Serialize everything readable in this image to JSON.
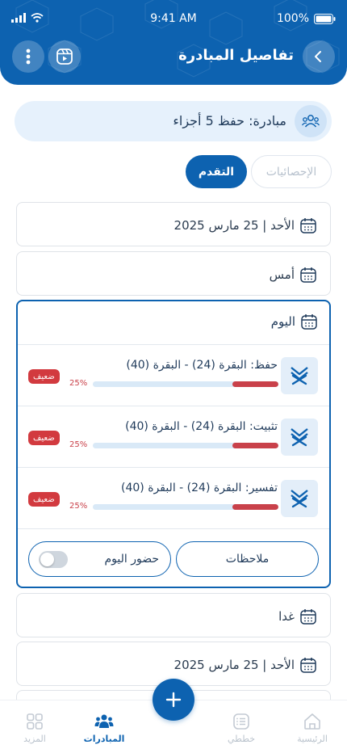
{
  "status_bar": {
    "time": "9:41 AM",
    "battery": "100%"
  },
  "header": {
    "title": "تفاصيل المبادرة"
  },
  "initiative": {
    "label": "مبادرة: حفظ 5 أجزاء"
  },
  "tabs": [
    {
      "label": "التقدم",
      "active": true
    },
    {
      "label": "الإحصائيات",
      "active": false
    }
  ],
  "days_before": [
    {
      "label": "الأحد | 25 مارس 2025"
    },
    {
      "label": "أمس"
    }
  ],
  "today": {
    "label": "اليوم",
    "tasks": [
      {
        "title": "حفظ: البقرة (24) - البقرة (40)",
        "progress_percent": 25,
        "progress_text": "25%",
        "badge": "ضعيف"
      },
      {
        "title": "تثبيت: البقرة (24) - البقرة (40)",
        "progress_percent": 25,
        "progress_text": "25%",
        "badge": "ضعيف"
      },
      {
        "title": "تفسير: البقرة (24) - البقرة (40)",
        "progress_percent": 25,
        "progress_text": "25%",
        "badge": "ضعيف"
      }
    ],
    "notes_label": "ملاحظات",
    "attendance_label": "حضور اليوم",
    "attendance_on": false
  },
  "days_after": [
    {
      "label": "غدا"
    },
    {
      "label": "الأحد | 25 مارس 2025"
    }
  ],
  "bottom_nav": [
    {
      "label": "الرئيسية",
      "icon": "home-icon"
    },
    {
      "label": "خططي",
      "icon": "plans-icon"
    },
    {
      "label": "المبادرات",
      "icon": "initiatives-icon",
      "active": true
    },
    {
      "label": "المزيد",
      "icon": "grid-icon"
    }
  ],
  "colors": {
    "primary": "#0d62b0",
    "weak": "#d23a3f",
    "bar_track": "#d9e9f7",
    "banner_bg": "#e6f1fc"
  }
}
